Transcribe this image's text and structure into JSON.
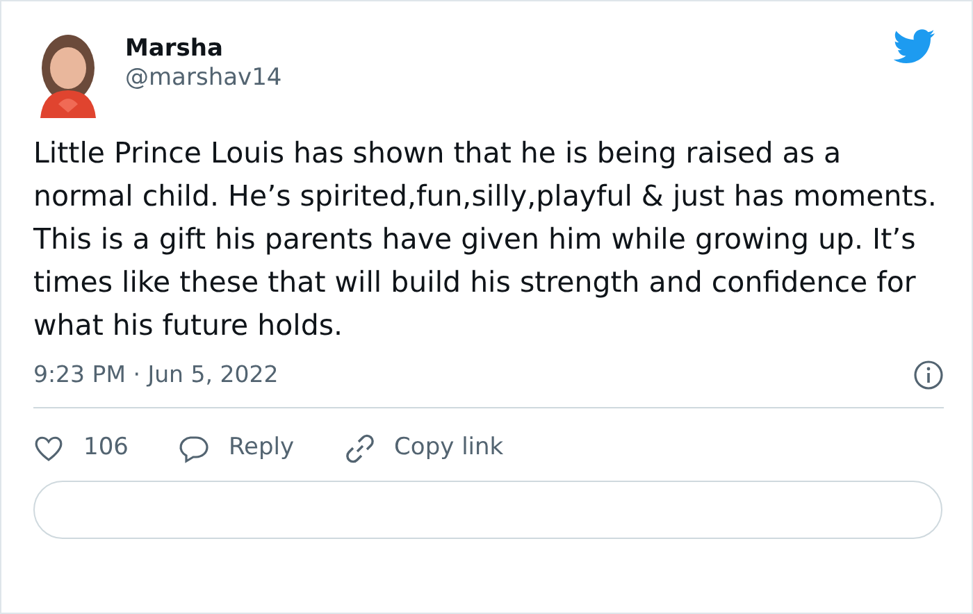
{
  "author": {
    "name": "Marsha",
    "handle": "@marshav14"
  },
  "tweet": {
    "text": "Little Prince Louis has shown that he is being raised as a normal child. He’s spirited,fun,silly,playful & just has moments. This is a gift his parents have given him while growing up. It’s times like these that will build his strength and confidence for what his future holds.",
    "timestamp": "9:23 PM · Jun 5, 2022"
  },
  "actions": [
    {
      "kind": "like",
      "label": "106"
    },
    {
      "kind": "reply",
      "label": "Reply"
    },
    {
      "kind": "link",
      "label": "Copy link"
    }
  ]
}
